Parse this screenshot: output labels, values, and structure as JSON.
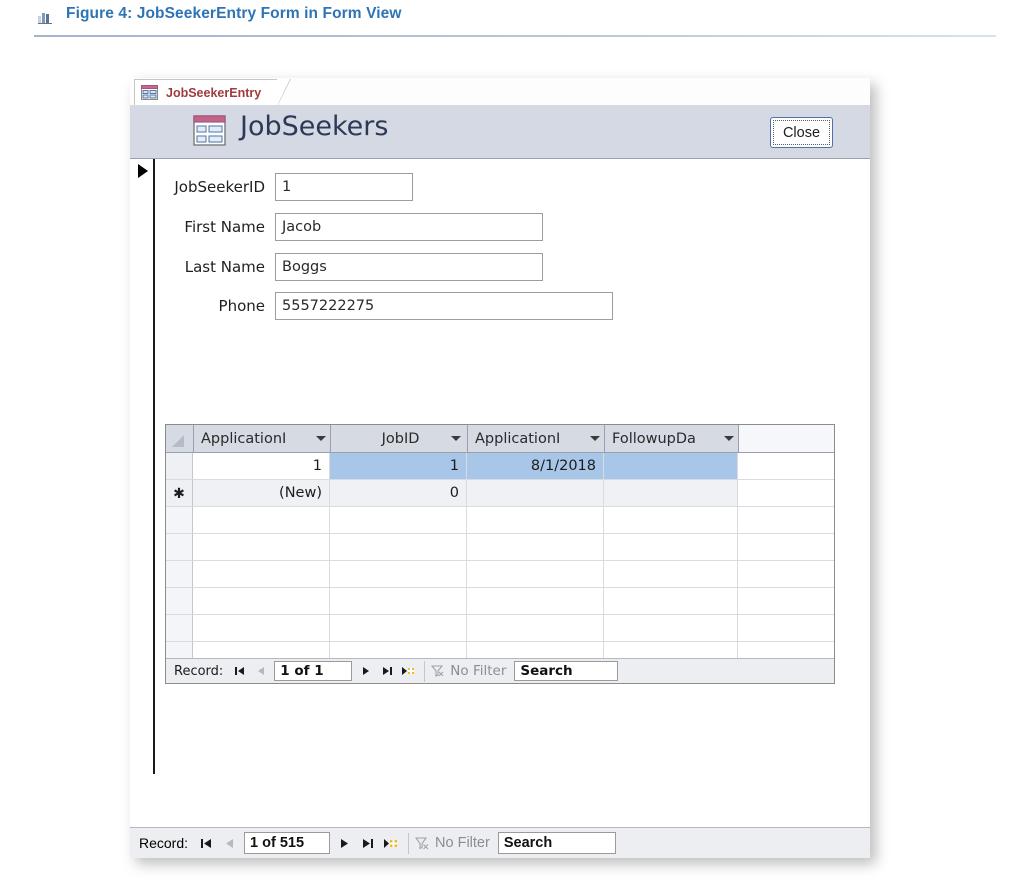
{
  "figure": {
    "icon": "chart-figure-icon",
    "caption": "Figure 4: JobSeekerEntry Form in Form View",
    "caption_color": "#2E74B5"
  },
  "window": {
    "tab": {
      "icon": "form-icon",
      "label": "JobSeekerEntry"
    },
    "header": {
      "icon": "form-icon",
      "title": "JobSeekers",
      "close_label": "Close",
      "band_color": "#d4d9e3"
    },
    "fields": [
      {
        "label": "JobSeekerID",
        "value": "1"
      },
      {
        "label": "First Name",
        "value": "Jacob"
      },
      {
        "label": "Last Name",
        "value": "Boggs"
      },
      {
        "label": "Phone",
        "value": "5557222275"
      }
    ],
    "subform": {
      "columns": [
        {
          "header": "ApplicationI"
        },
        {
          "header": "JobID"
        },
        {
          "header": "ApplicationI"
        },
        {
          "header": "FollowupDa"
        },
        {
          "header": ""
        }
      ],
      "rows": [
        {
          "selector": "",
          "cells": [
            "1",
            "1",
            "8/1/2018",
            "",
            ""
          ]
        },
        {
          "selector": "✱",
          "cells": [
            "(New)",
            "0",
            "",
            "",
            ""
          ]
        }
      ],
      "navigator": {
        "label": "Record:",
        "position": "1 of 1",
        "filter_label": "No Filter",
        "search_value": "Search",
        "first_icon": "first-record-icon",
        "prev_icon": "previous-record-icon",
        "next_icon": "next-record-icon",
        "last_icon": "last-record-icon",
        "new_icon": "new-record-icon",
        "filter_icon": "filter-off-icon"
      },
      "selection_color": "#a8c7e8"
    },
    "navigator": {
      "label": "Record:",
      "position": "1 of 515",
      "filter_label": "No Filter",
      "search_value": "Search",
      "first_icon": "first-record-icon",
      "prev_icon": "previous-record-icon",
      "next_icon": "next-record-icon",
      "last_icon": "last-record-icon",
      "new_icon": "new-record-icon",
      "filter_icon": "filter-off-icon"
    }
  }
}
